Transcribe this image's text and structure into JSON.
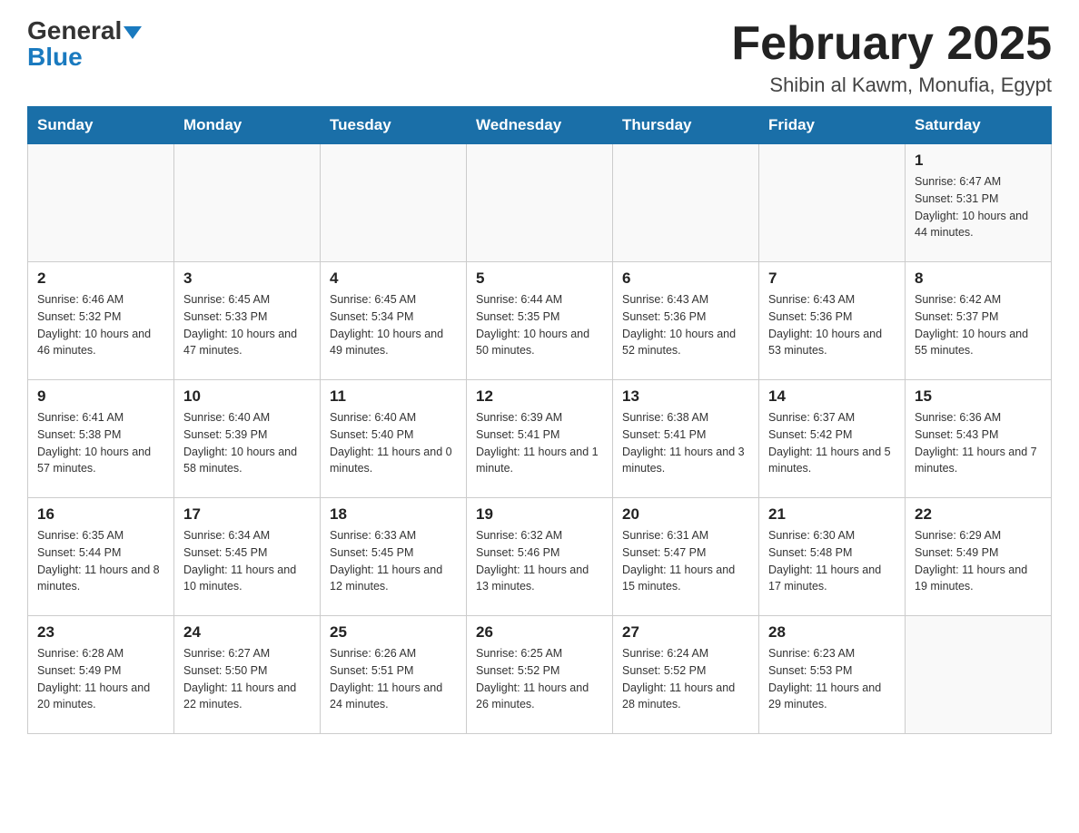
{
  "header": {
    "logo_line1": "General",
    "logo_line2": "Blue",
    "month_title": "February 2025",
    "subtitle": "Shibin al Kawm, Monufia, Egypt"
  },
  "days_of_week": [
    "Sunday",
    "Monday",
    "Tuesday",
    "Wednesday",
    "Thursday",
    "Friday",
    "Saturday"
  ],
  "weeks": [
    [
      {
        "day": "",
        "info": ""
      },
      {
        "day": "",
        "info": ""
      },
      {
        "day": "",
        "info": ""
      },
      {
        "day": "",
        "info": ""
      },
      {
        "day": "",
        "info": ""
      },
      {
        "day": "",
        "info": ""
      },
      {
        "day": "1",
        "info": "Sunrise: 6:47 AM\nSunset: 5:31 PM\nDaylight: 10 hours and 44 minutes."
      }
    ],
    [
      {
        "day": "2",
        "info": "Sunrise: 6:46 AM\nSunset: 5:32 PM\nDaylight: 10 hours and 46 minutes."
      },
      {
        "day": "3",
        "info": "Sunrise: 6:45 AM\nSunset: 5:33 PM\nDaylight: 10 hours and 47 minutes."
      },
      {
        "day": "4",
        "info": "Sunrise: 6:45 AM\nSunset: 5:34 PM\nDaylight: 10 hours and 49 minutes."
      },
      {
        "day": "5",
        "info": "Sunrise: 6:44 AM\nSunset: 5:35 PM\nDaylight: 10 hours and 50 minutes."
      },
      {
        "day": "6",
        "info": "Sunrise: 6:43 AM\nSunset: 5:36 PM\nDaylight: 10 hours and 52 minutes."
      },
      {
        "day": "7",
        "info": "Sunrise: 6:43 AM\nSunset: 5:36 PM\nDaylight: 10 hours and 53 minutes."
      },
      {
        "day": "8",
        "info": "Sunrise: 6:42 AM\nSunset: 5:37 PM\nDaylight: 10 hours and 55 minutes."
      }
    ],
    [
      {
        "day": "9",
        "info": "Sunrise: 6:41 AM\nSunset: 5:38 PM\nDaylight: 10 hours and 57 minutes."
      },
      {
        "day": "10",
        "info": "Sunrise: 6:40 AM\nSunset: 5:39 PM\nDaylight: 10 hours and 58 minutes."
      },
      {
        "day": "11",
        "info": "Sunrise: 6:40 AM\nSunset: 5:40 PM\nDaylight: 11 hours and 0 minutes."
      },
      {
        "day": "12",
        "info": "Sunrise: 6:39 AM\nSunset: 5:41 PM\nDaylight: 11 hours and 1 minute."
      },
      {
        "day": "13",
        "info": "Sunrise: 6:38 AM\nSunset: 5:41 PM\nDaylight: 11 hours and 3 minutes."
      },
      {
        "day": "14",
        "info": "Sunrise: 6:37 AM\nSunset: 5:42 PM\nDaylight: 11 hours and 5 minutes."
      },
      {
        "day": "15",
        "info": "Sunrise: 6:36 AM\nSunset: 5:43 PM\nDaylight: 11 hours and 7 minutes."
      }
    ],
    [
      {
        "day": "16",
        "info": "Sunrise: 6:35 AM\nSunset: 5:44 PM\nDaylight: 11 hours and 8 minutes."
      },
      {
        "day": "17",
        "info": "Sunrise: 6:34 AM\nSunset: 5:45 PM\nDaylight: 11 hours and 10 minutes."
      },
      {
        "day": "18",
        "info": "Sunrise: 6:33 AM\nSunset: 5:45 PM\nDaylight: 11 hours and 12 minutes."
      },
      {
        "day": "19",
        "info": "Sunrise: 6:32 AM\nSunset: 5:46 PM\nDaylight: 11 hours and 13 minutes."
      },
      {
        "day": "20",
        "info": "Sunrise: 6:31 AM\nSunset: 5:47 PM\nDaylight: 11 hours and 15 minutes."
      },
      {
        "day": "21",
        "info": "Sunrise: 6:30 AM\nSunset: 5:48 PM\nDaylight: 11 hours and 17 minutes."
      },
      {
        "day": "22",
        "info": "Sunrise: 6:29 AM\nSunset: 5:49 PM\nDaylight: 11 hours and 19 minutes."
      }
    ],
    [
      {
        "day": "23",
        "info": "Sunrise: 6:28 AM\nSunset: 5:49 PM\nDaylight: 11 hours and 20 minutes."
      },
      {
        "day": "24",
        "info": "Sunrise: 6:27 AM\nSunset: 5:50 PM\nDaylight: 11 hours and 22 minutes."
      },
      {
        "day": "25",
        "info": "Sunrise: 6:26 AM\nSunset: 5:51 PM\nDaylight: 11 hours and 24 minutes."
      },
      {
        "day": "26",
        "info": "Sunrise: 6:25 AM\nSunset: 5:52 PM\nDaylight: 11 hours and 26 minutes."
      },
      {
        "day": "27",
        "info": "Sunrise: 6:24 AM\nSunset: 5:52 PM\nDaylight: 11 hours and 28 minutes."
      },
      {
        "day": "28",
        "info": "Sunrise: 6:23 AM\nSunset: 5:53 PM\nDaylight: 11 hours and 29 minutes."
      },
      {
        "day": "",
        "info": ""
      }
    ]
  ]
}
